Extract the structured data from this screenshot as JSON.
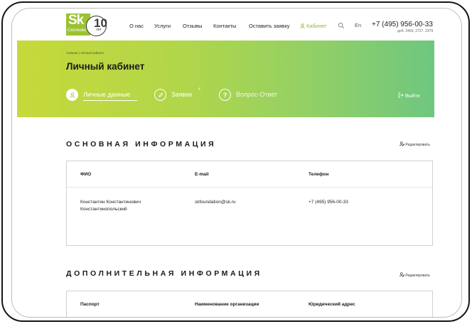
{
  "header": {
    "logo_text": "Sk",
    "logo_sub": "Сколково",
    "logo_num": "10",
    "logo_let": "лет",
    "nav": [
      "О нас",
      "Услуги",
      "Отзывы",
      "Контакты",
      "Оставить заявку"
    ],
    "cabinet": "Кабинет",
    "lang": "En",
    "phone": "+7 (495) 956-00-33",
    "phone_ext": "доб. 2403, 2727, 2379"
  },
  "banner": {
    "breadcrumbs": "главная  |  личный кабинет",
    "title": "Личный кабинет",
    "tabs": [
      {
        "label": "Личные данные",
        "active": true
      },
      {
        "label": "Заявки",
        "badge": "4"
      },
      {
        "label": "Вопрос-Ответ"
      }
    ],
    "logout": "Выйти"
  },
  "main_info": {
    "title": "ОСНОВНАЯ ИНФОРМАЦИЯ",
    "edit": "Редактировать",
    "headers": [
      "ФИО",
      "E-mail",
      "Телефон"
    ],
    "row": {
      "fio_line1": "Константин Константинович",
      "fio_line2": "Константинопольский",
      "email": "skfoundation@sk.ru",
      "phone": "+7 (495) 956-00-33"
    }
  },
  "extra_info": {
    "title": "ДОПОЛНИТЕЛЬНАЯ ИНФОРМАЦИЯ",
    "edit": "Редактировать",
    "headers": [
      "Паспорт",
      "Наименование организации",
      "Юридический адрес"
    ]
  },
  "colors": {
    "accent": "#8bbd27",
    "banner_start": "#c6d93a",
    "banner_end": "#6ec780"
  }
}
